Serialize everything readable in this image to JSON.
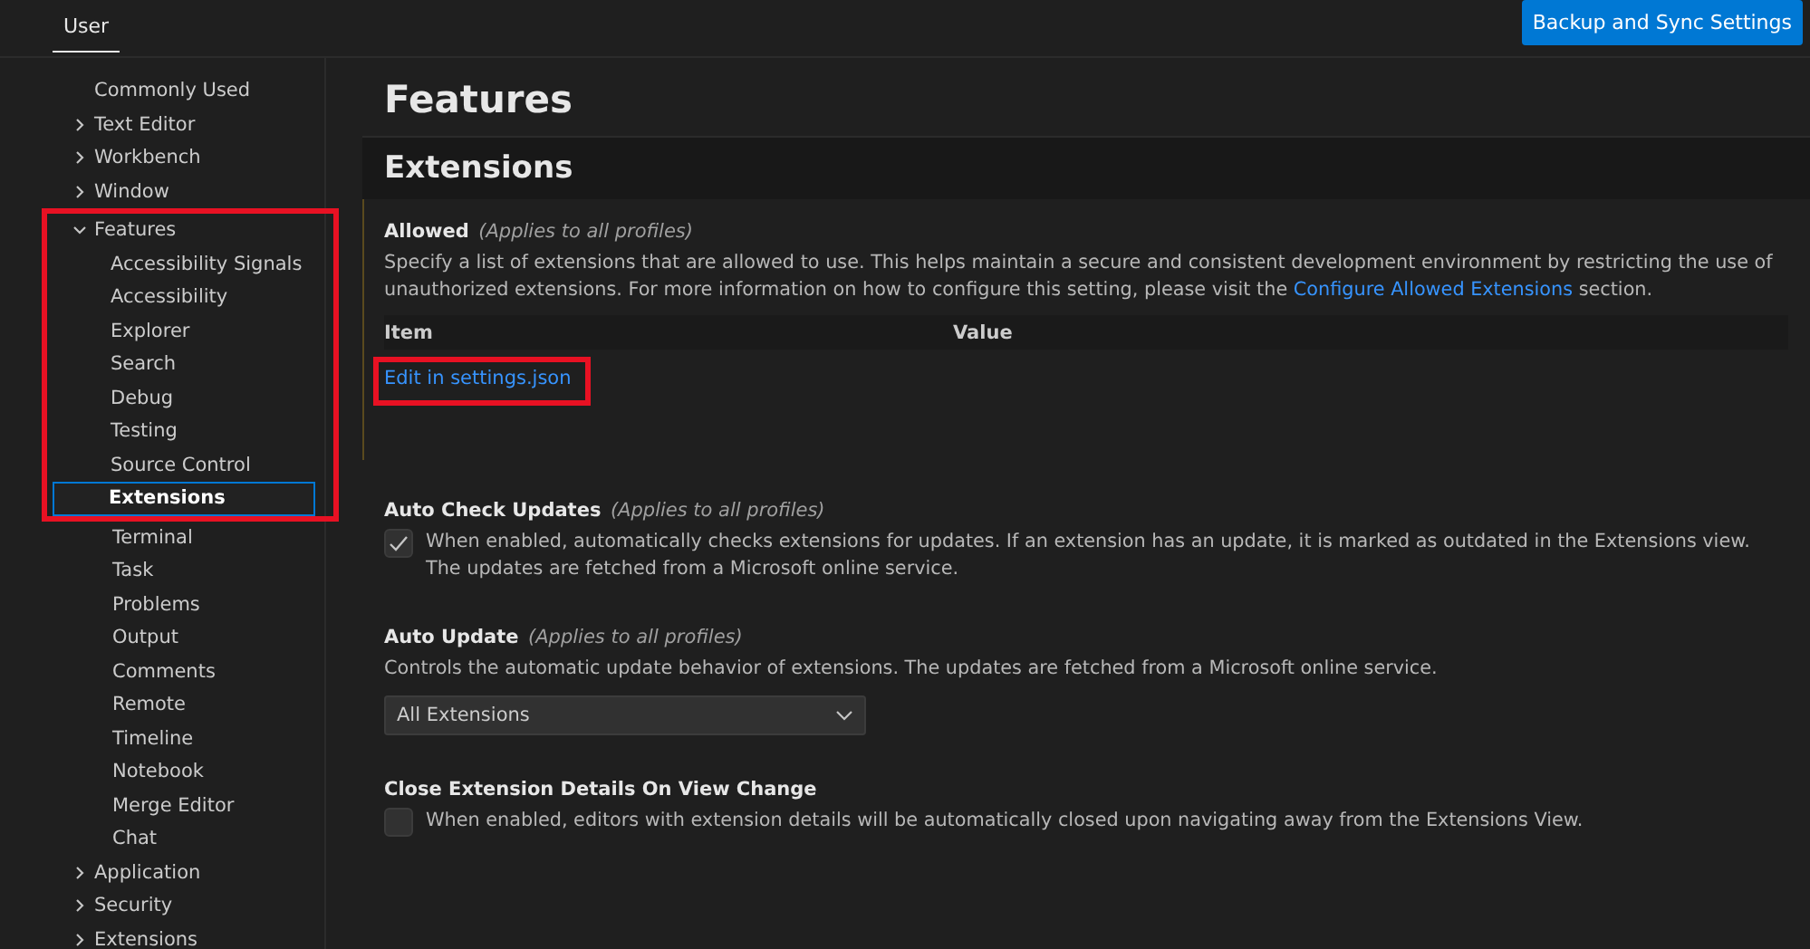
{
  "tabs": [
    {
      "label": "User",
      "selected": true
    }
  ],
  "sync_button": "Backup and Sync Settings",
  "sidebar": {
    "items": [
      {
        "label": "Commonly Used",
        "selected": false
      },
      {
        "label": "Text Editor",
        "expanded": false,
        "selected": false
      },
      {
        "label": "Workbench",
        "expanded": false,
        "selected": false
      },
      {
        "label": "Window",
        "expanded": false,
        "selected": false
      },
      {
        "label": "Features",
        "expanded": true,
        "selected": false,
        "highlighted": true,
        "children": [
          {
            "label": "Accessibility Signals",
            "selected": false
          },
          {
            "label": "Accessibility",
            "selected": false
          },
          {
            "label": "Explorer",
            "selected": false
          },
          {
            "label": "Search",
            "selected": false
          },
          {
            "label": "Debug",
            "selected": false
          },
          {
            "label": "Testing",
            "selected": false
          },
          {
            "label": "Source Control",
            "selected": false
          },
          {
            "label": "Extensions",
            "selected": true
          },
          {
            "label": "Terminal",
            "selected": false
          },
          {
            "label": "Task",
            "selected": false
          },
          {
            "label": "Problems",
            "selected": false
          },
          {
            "label": "Output",
            "selected": false
          },
          {
            "label": "Comments",
            "selected": false
          },
          {
            "label": "Remote",
            "selected": false
          },
          {
            "label": "Timeline",
            "selected": false
          },
          {
            "label": "Notebook",
            "selected": false
          },
          {
            "label": "Merge Editor",
            "selected": false
          },
          {
            "label": "Chat",
            "selected": false
          }
        ]
      },
      {
        "label": "Application",
        "expanded": false,
        "selected": false
      },
      {
        "label": "Security",
        "expanded": false,
        "selected": false
      },
      {
        "label": "Extensions",
        "expanded": false,
        "selected": false
      }
    ]
  },
  "page_title": "Features",
  "section_title": "Extensions",
  "settings": [
    {
      "kind": "list",
      "title": "Allowed",
      "scope": "(Applies to all profiles)",
      "description": "Specify a list of extensions that are allowed to use. This helps maintain a secure and consistent development environment by restricting the use of unauthorized extensions. For more information on how to configure this setting, please visit the",
      "link": "Configure Allowed Extensions",
      "description_end": "section.",
      "columns": [
        "Item",
        "Value"
      ],
      "edit_link": "Edit in settings.json",
      "highlighted": true,
      "focused": true
    },
    {
      "kind": "checkbox",
      "title": "Auto Check Updates",
      "scope": "(Applies to all profiles)",
      "description": "When enabled, automatically checks extensions for updates. If an extension has an update, it is marked as outdated in the Extensions view. The updates are fetched from a Microsoft online service.",
      "checked": true
    },
    {
      "kind": "dropdown",
      "title": "Auto Update",
      "scope": "(Applies to all profiles)",
      "description": "Controls the automatic update behavior of extensions. The updates are fetched from a Microsoft online service.",
      "value": "All Extensions"
    },
    {
      "kind": "checkbox",
      "title": "Close Extension Details On View Change",
      "description": "When enabled, editors with extension details will be automatically closed upon navigating away from the Extensions View.",
      "checked": false
    }
  ]
}
